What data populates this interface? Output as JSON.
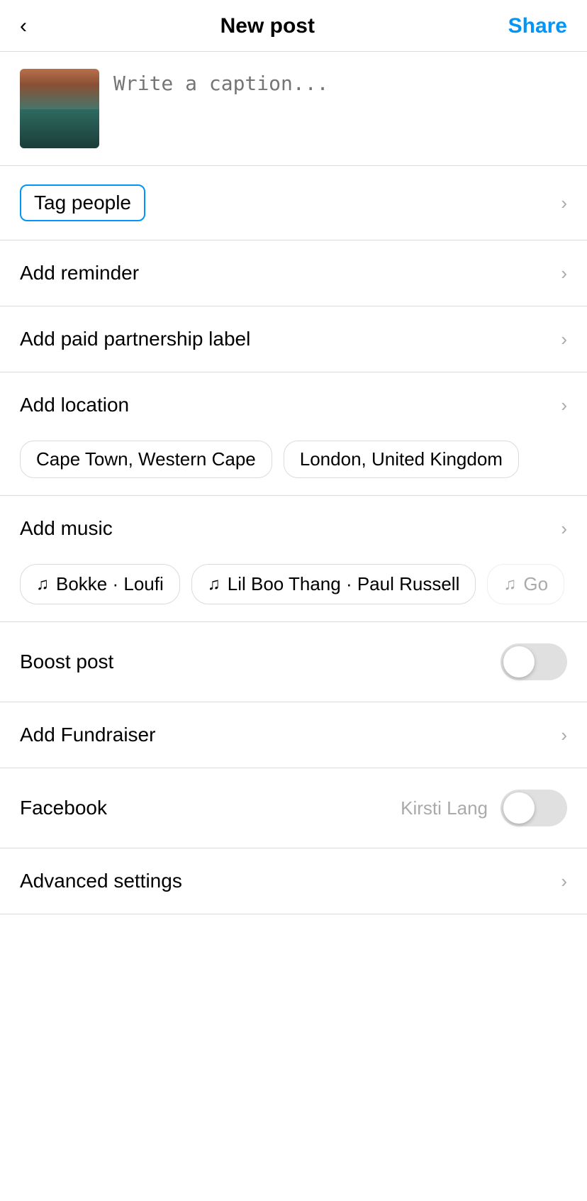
{
  "header": {
    "back_label": "‹",
    "title": "New post",
    "share_label": "Share"
  },
  "caption": {
    "placeholder": "Write a caption..."
  },
  "tag_people": {
    "label": "Tag people"
  },
  "menu_items": [
    {
      "id": "add-reminder",
      "label": "Add reminder"
    },
    {
      "id": "add-paid-partnership",
      "label": "Add paid partnership label"
    },
    {
      "id": "add-location",
      "label": "Add location"
    }
  ],
  "location_chips": [
    {
      "id": "cape-town",
      "label": "Cape Town, Western Cape"
    },
    {
      "id": "london",
      "label": "London, United Kingdom"
    }
  ],
  "add_music": {
    "label": "Add music"
  },
  "music_chips": [
    {
      "id": "bokke",
      "label": "Bokke · Loufi"
    },
    {
      "id": "lil-boo",
      "label": "Lil Boo Thang · Paul Russell"
    },
    {
      "id": "third",
      "label": "Go"
    }
  ],
  "boost_post": {
    "label": "Boost post",
    "enabled": false
  },
  "add_fundraiser": {
    "label": "Add Fundraiser"
  },
  "facebook": {
    "label": "Facebook",
    "user": "Kirsti Lang",
    "enabled": false
  },
  "advanced_settings": {
    "label": "Advanced settings"
  }
}
